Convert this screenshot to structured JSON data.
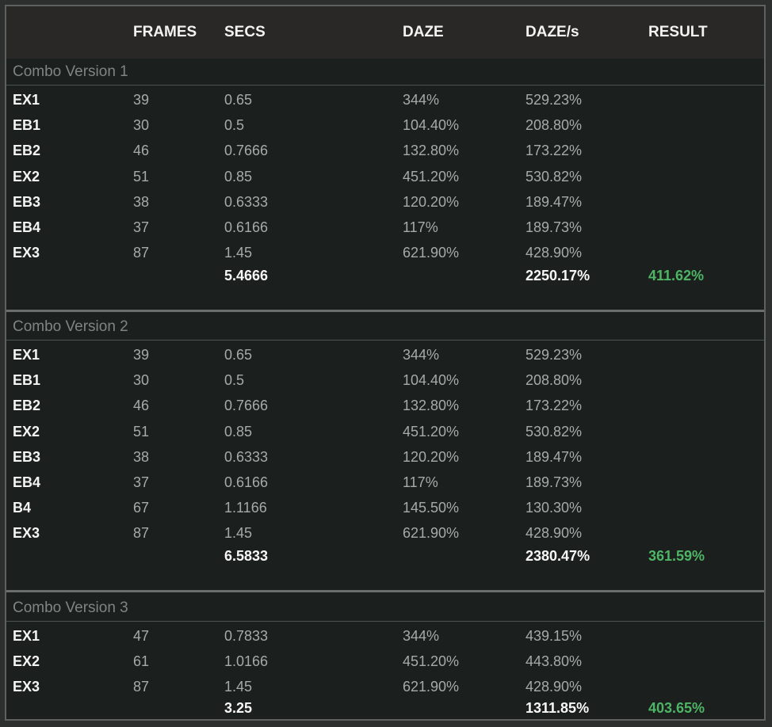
{
  "header": {
    "columns": [
      "FRAMES",
      "SECS",
      "DAZE",
      "DAZE/s",
      "RESULT"
    ]
  },
  "sections": [
    {
      "title": "Combo Version 1",
      "rows": [
        [
          "EX1",
          "39",
          "0.65",
          "344%",
          "529.23%"
        ],
        [
          "EB1",
          "30",
          "0.5",
          "104.40%",
          "208.80%"
        ],
        [
          "EB2",
          "46",
          "0.7666",
          "132.80%",
          "173.22%"
        ],
        [
          "EX2",
          "51",
          "0.85",
          "451.20%",
          "530.82%"
        ],
        [
          "EB3",
          "38",
          "0.6333",
          "120.20%",
          "189.47%"
        ],
        [
          "EB4",
          "37",
          "0.6166",
          "117%",
          "189.73%"
        ],
        [
          "EX3",
          "87",
          "1.45",
          "621.90%",
          "428.90%"
        ]
      ],
      "total": {
        "secs": "5.4666",
        "dazes": "2250.17%",
        "result": "411.62%"
      }
    },
    {
      "title": "Combo Version 2",
      "rows": [
        [
          "EX1",
          "39",
          "0.65",
          "344%",
          "529.23%"
        ],
        [
          "EB1",
          "30",
          "0.5",
          "104.40%",
          "208.80%"
        ],
        [
          "EB2",
          "46",
          "0.7666",
          "132.80%",
          "173.22%"
        ],
        [
          "EX2",
          "51",
          "0.85",
          "451.20%",
          "530.82%"
        ],
        [
          "EB3",
          "38",
          "0.6333",
          "120.20%",
          "189.47%"
        ],
        [
          "EB4",
          "37",
          "0.6166",
          "117%",
          "189.73%"
        ],
        [
          "B4",
          "67",
          "1.1166",
          "145.50%",
          "130.30%"
        ],
        [
          "EX3",
          "87",
          "1.45",
          "621.90%",
          "428.90%"
        ]
      ],
      "total": {
        "secs": "6.5833",
        "dazes": "2380.47%",
        "result": "361.59%"
      }
    },
    {
      "title": "Combo Version 3",
      "rows": [
        [
          "EX1",
          "47",
          "0.7833",
          "344%",
          "439.15%"
        ],
        [
          "EX2",
          "61",
          "1.0166",
          "451.20%",
          "443.80%"
        ],
        [
          "EX3",
          "87",
          "1.45",
          "621.90%",
          "428.90%"
        ]
      ],
      "total": {
        "secs": "3.25",
        "dazes": "1311.85%",
        "result": "403.65%"
      }
    }
  ]
}
